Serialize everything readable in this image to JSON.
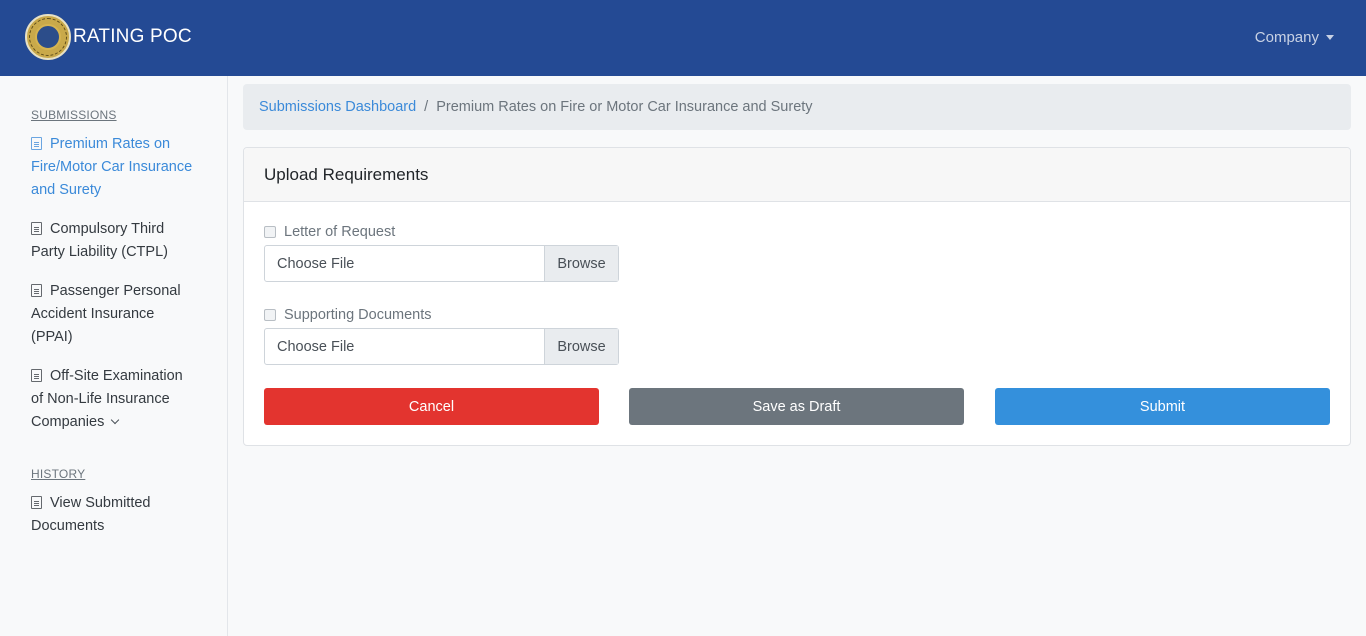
{
  "app": {
    "title": "RATING POC",
    "user_menu": "Company"
  },
  "sidebar": {
    "sections": [
      {
        "heading": "SUBMISSIONS"
      },
      {
        "heading": "HISTORY"
      }
    ],
    "items": [
      {
        "label": "Premium Rates on Fire/Motor Car Insurance and Surety",
        "active": true
      },
      {
        "label": "Compulsory Third Party Liability (CTPL)"
      },
      {
        "label": "Passenger Personal Accident Insurance (PPAI)"
      },
      {
        "label": "Off-Site Examination of Non-Life Insurance Companies"
      },
      {
        "label": "View Submitted Documents"
      }
    ]
  },
  "breadcrumb": {
    "link": "Submissions Dashboard",
    "separator": "/",
    "current": "Premium Rates on Fire or Motor Car Insurance and Surety"
  },
  "card": {
    "title": "Upload Requirements",
    "fields": [
      {
        "label": "Letter of Request",
        "placeholder": "Choose File",
        "browse": "Browse"
      },
      {
        "label": "Supporting Documents",
        "placeholder": "Choose File",
        "browse": "Browse"
      }
    ],
    "buttons": {
      "cancel": "Cancel",
      "draft": "Save as Draft",
      "submit": "Submit"
    }
  },
  "colors": {
    "navbar": "#244a94",
    "link": "#3b8ad9",
    "cancel": "#e3342f",
    "draft": "#6c757d",
    "submit": "#3490dc"
  },
  "icons": {
    "logo": "insurance-commission-seal",
    "nav": "file-text-icon",
    "expand": "chevron-down-icon",
    "user_menu": "caret-down-icon"
  }
}
